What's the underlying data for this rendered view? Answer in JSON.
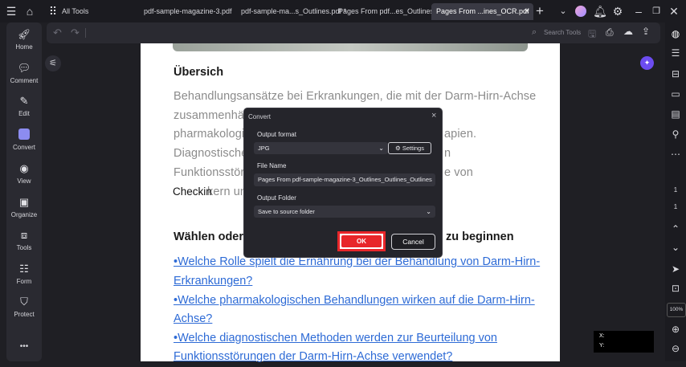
{
  "topbar": {
    "all_tools_label": "All Tools",
    "tabs": [
      {
        "label": "pdf-sample-magazine-3.pdf"
      },
      {
        "label": "pdf-sample-ma...s_Outlines.pdf *"
      },
      {
        "label": "Pages From pdf...es_Outlines.pdf"
      },
      {
        "label": "Pages From ...ines_OCR.pdf"
      }
    ]
  },
  "sidebar": {
    "items": [
      {
        "label": "Home",
        "icon": "rocket-icon"
      },
      {
        "label": "Comment",
        "icon": "comment-icon"
      },
      {
        "label": "Edit",
        "icon": "edit-icon"
      },
      {
        "label": "Convert",
        "icon": "convert-icon"
      },
      {
        "label": "View",
        "icon": "eye-icon"
      },
      {
        "label": "Organize",
        "icon": "organize-icon"
      },
      {
        "label": "Tools",
        "icon": "toolbox-icon"
      },
      {
        "label": "Form",
        "icon": "form-icon"
      },
      {
        "label": "Protect",
        "icon": "shield-icon"
      }
    ],
    "more": "•••"
  },
  "toolbar": {
    "search_placeholder": "Search Tools"
  },
  "document": {
    "heading1": "Übersich",
    "lines": [
      "Behandlungsansätze bei Erkrankungen, die mit der Darm-Hirn-Achse",
      "zusammenhän",
      "pharmakologis",
      "Diagnostische",
      "Funktionsstörun",
      "kern un"
    ],
    "line_tails": [
      "apien.",
      "n",
      "e von"
    ],
    "checkin": "Checkin",
    "heading2_left": "Wählen oder s",
    "heading2_right": "zu beginnen",
    "links": [
      "•Welche Rolle spielt die Ernährung bei der Behandlung von Darm-Hirn-",
      "Erkrankungen?",
      "•Welche pharmakologischen Behandlungen wirken auf die Darm-Hirn-",
      "Achse?",
      "•Welche diagnostischen Methoden werden zur Beurteilung von",
      "Funktionsstörungen der Darm-Hirn-Achse verwendet?"
    ]
  },
  "rightbar": {
    "page_current": "1",
    "page_total": "1",
    "zoom": "100%"
  },
  "coords": {
    "x_label": "X:",
    "y_label": "Y:"
  },
  "dialog": {
    "title": "Convert",
    "output_format_label": "Output format",
    "output_format_value": "JPG",
    "settings_label": "Settings",
    "file_name_label": "File Name",
    "file_name_value": "Pages From pdf-sample-magazine-3_Outlines_Outlines_Outlines",
    "output_folder_label": "Output Folder",
    "output_folder_value": "Save to source folder",
    "ok_label": "OK",
    "cancel_label": "Cancel"
  },
  "colors": {
    "accent_red": "#e8262a",
    "link_blue": "#2e6bd6"
  }
}
